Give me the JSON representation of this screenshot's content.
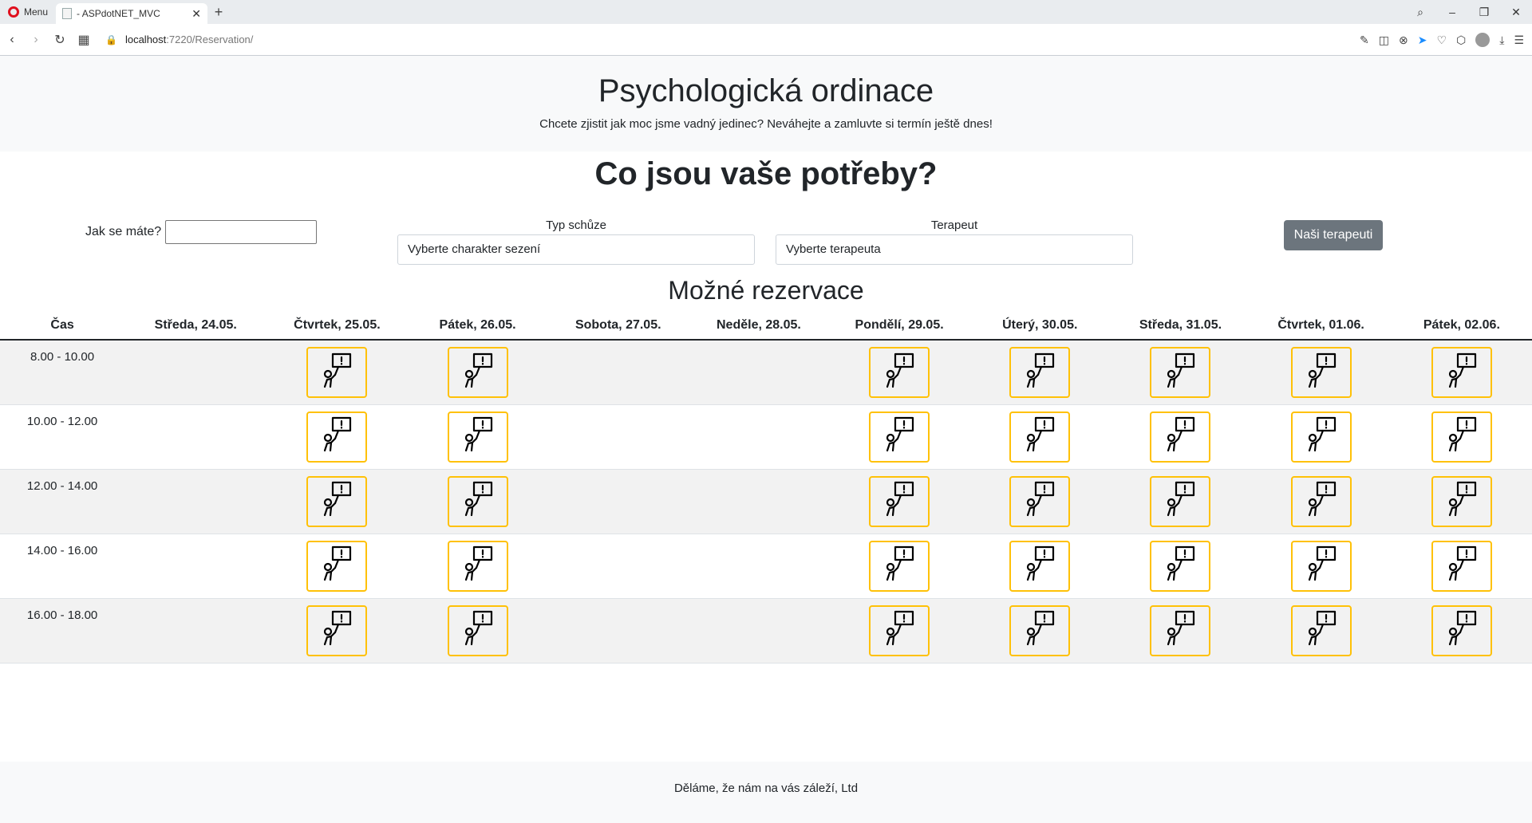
{
  "browser": {
    "menu_label": "Menu",
    "tab_title": "- ASPdotNET_MVC",
    "tab_close": "✕",
    "new_tab": "+",
    "url_host": "localhost",
    "url_rest": ":7220/Reservation/"
  },
  "hero": {
    "title": "Psychologická ordinace",
    "subtitle": "Chcete zjistit jak moc jsme vadný jedinec? Neváhejte a zamluvte si termín ještě dnes!"
  },
  "needs": {
    "title": "Co jsou vaše potřeby?",
    "mood_label": "Jak se máte?",
    "mood_value": "",
    "type_label": "Typ schůze",
    "type_value": "Vyberte charakter sezení",
    "therapist_label": "Terapeut",
    "therapist_value": "Vyberte terapeuta",
    "therapists_button": "Naši terapeuti"
  },
  "reservations": {
    "title": "Možné rezervace",
    "time_header": "Čas",
    "days": [
      "Středa, 24.05.",
      "Čtvrtek, 25.05.",
      "Pátek, 26.05.",
      "Sobota, 27.05.",
      "Neděle, 28.05.",
      "Pondělí, 29.05.",
      "Úterý, 30.05.",
      "Středa, 31.05.",
      "Čtvrtek, 01.06.",
      "Pátek, 02.06."
    ],
    "times": [
      "8.00 - 10.00",
      "10.00 - 12.00",
      "12.00 - 14.00",
      "14.00 - 16.00",
      "16.00 - 18.00"
    ],
    "available_days": [
      false,
      true,
      true,
      false,
      false,
      true,
      true,
      true,
      true,
      true
    ],
    "slot_icon": "reservation-sign-icon",
    "slot_color": "#ffc107"
  },
  "footer": {
    "text": "Děláme, že nám na vás záleží, Ltd"
  }
}
